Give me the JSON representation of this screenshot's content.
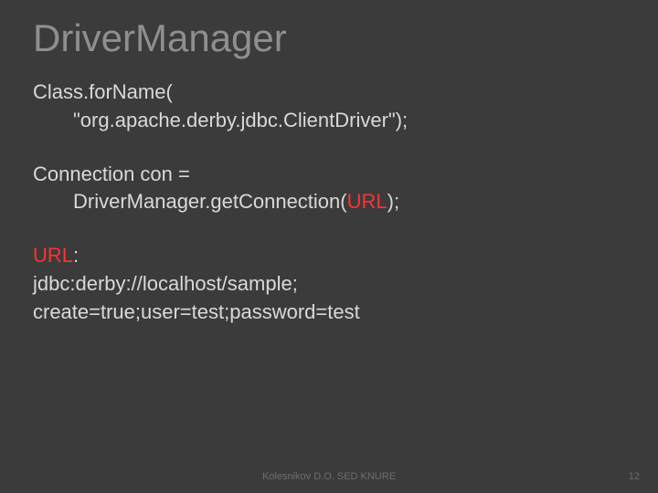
{
  "title": "DriverManager",
  "lines": {
    "l1": "Class.forName(",
    "l2": "\"org.apache.derby.jdbc.ClientDriver\");",
    "l3": "Connection con =",
    "l4a": "DriverManager.getConnection(",
    "l4b": "URL",
    "l4c": ");",
    "l5a": "URL",
    "l5b": ":",
    "l6": "jdbc:derby://localhost/sample;",
    "l7": "create=true;user=test;password=test"
  },
  "footer": "Kolesnikov D.O. SED KNURE",
  "page": "12"
}
